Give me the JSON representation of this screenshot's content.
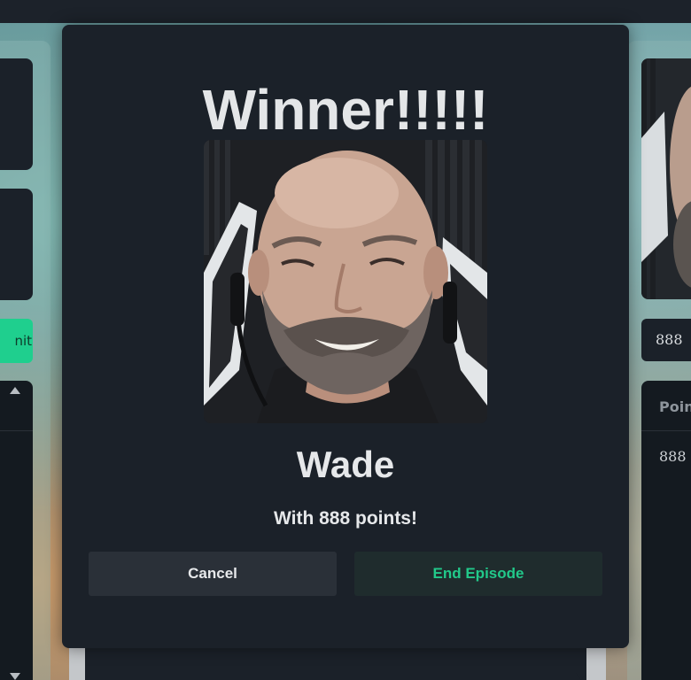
{
  "background": {
    "left_panel": {
      "submit_label_partial": "nit"
    },
    "right_panel": {
      "points_input_value": "888",
      "table_header_partial": "Poin",
      "table_cell_value": "888"
    }
  },
  "modal": {
    "title": "Winner!!!!!",
    "winner_name": "Wade",
    "points_text": "With 888 points!",
    "cancel_label": "Cancel",
    "end_label": "End Episode"
  },
  "colors": {
    "accent_green": "#22c98a",
    "modal_bg": "#1b2129",
    "cancel_bg": "#2a3038",
    "end_bg": "#1f2c2d"
  }
}
